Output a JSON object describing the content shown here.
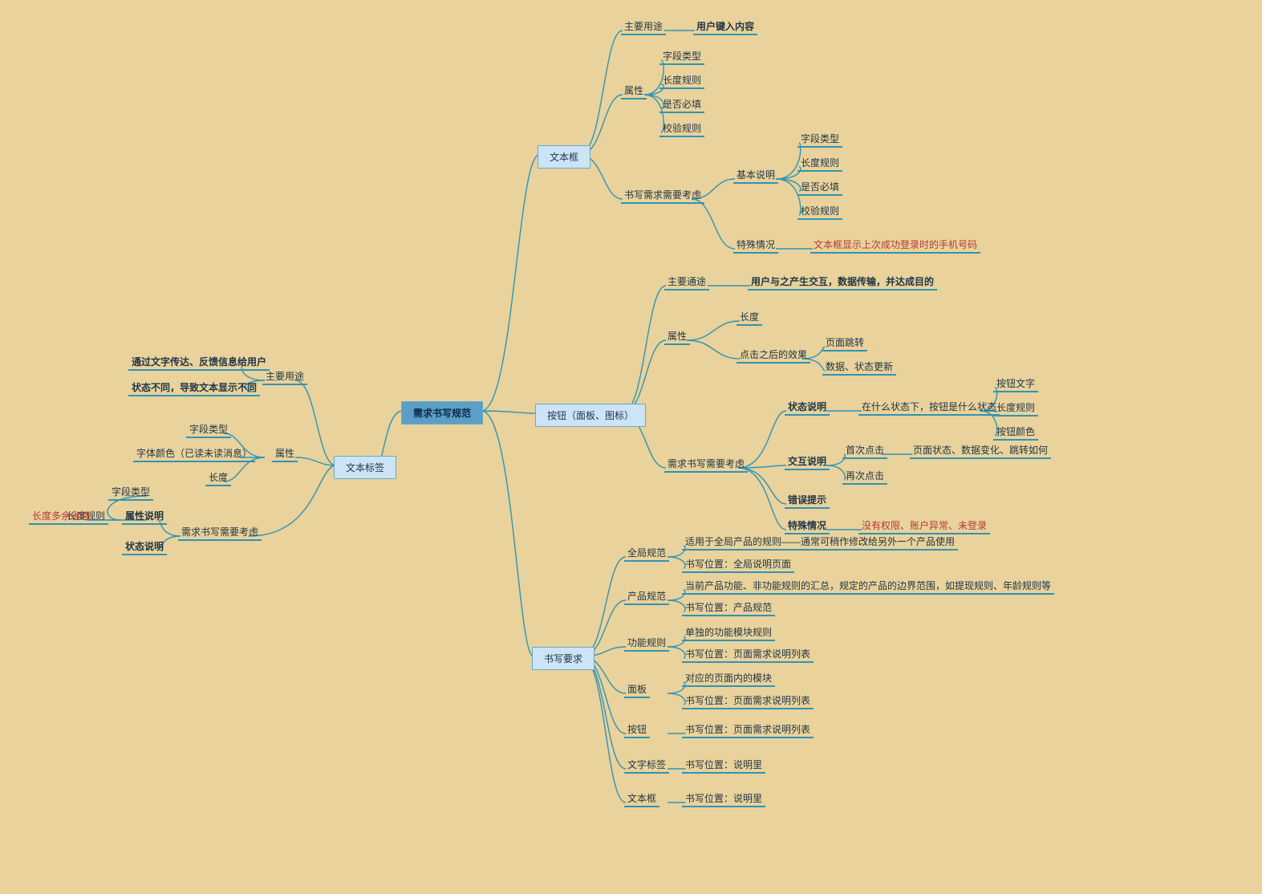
{
  "root": "需求书写规范",
  "n": {
    "lab": "文本标签",
    "form": "文本框",
    "btn": "按钮（面板、图标）",
    "req": "书写要求",
    "l1": "主要用途",
    "l1a": "通过文字传达、反馈信息给用户",
    "l1b": "状态不同，导致文本显示不同",
    "l2": "属性",
    "l2a": "字段类型",
    "l2b": "字体颜色（已读未读消息）",
    "l2c": "长度",
    "l3": "需求书写需要考虑",
    "l3a": "属性说明",
    "l3b": "状态说明",
    "l3a1": "字段类型",
    "l3a2": "长度规则",
    "l3a3": "长度多余省略",
    "f1": "主要用途",
    "f1a": "用户键入内容",
    "f2": "属性",
    "f2a": "字段类型",
    "f2b": "长度规则",
    "f2c": "是否必填",
    "f2d": "校验规则",
    "f3": "书写需求需要考虑",
    "f31": "基本说明",
    "f31a": "字段类型",
    "f31b": "长度规则",
    "f31c": "是否必填",
    "f31d": "校验规则",
    "f32": "特殊情况",
    "f32a": "文本框显示上次成功登录时的手机号码",
    "b1": "主要通途",
    "b1a": "用户与之产生交互，数据传输，并达成目的",
    "b2": "属性",
    "b21": "长度",
    "b22": "点击之后的效果",
    "b22a": "页面跳转",
    "b22b": "数据、状态更新",
    "b3": "需求书写需要考虑",
    "b31": "状态说明",
    "b31a": "在什么状态下，按钮是什么状态",
    "b31a1": "按钮文字",
    "b31a2": "长度规则",
    "b31a3": "按钮颜色",
    "b32": "交互说明",
    "b32a": "首次点击",
    "b32a1": "页面状态、数据变化、跳转如何",
    "b32b": "再次点击",
    "b33": "错误提示",
    "b34": "特殊情况",
    "b34a": "没有权限、账户异常、未登录",
    "r1": "全局规范",
    "r1a": "适用于全局产品的规则——通常可稍作修改给另外一个产品使用",
    "r1b": "书写位置：全局说明页面",
    "r2": "产品规范",
    "r2a": "当前产品功能、非功能规则的汇总，规定的产品的边界范围，如提现规则、年龄规则等",
    "r2b": "书写位置：产品规范",
    "r3": "功能规则",
    "r3a": "单独的功能模块规则",
    "r3b": "书写位置：页面需求说明列表",
    "r4": "面板",
    "r4a": "对应的页面内的模块",
    "r4b": "书写位置：页面需求说明列表",
    "r5": "按钮",
    "r5a": "书写位置：页面需求说明列表",
    "r6": "文字标签",
    "r6a": "书写位置：说明里",
    "r7": "文本框",
    "r7a": "书写位置：说明里"
  }
}
